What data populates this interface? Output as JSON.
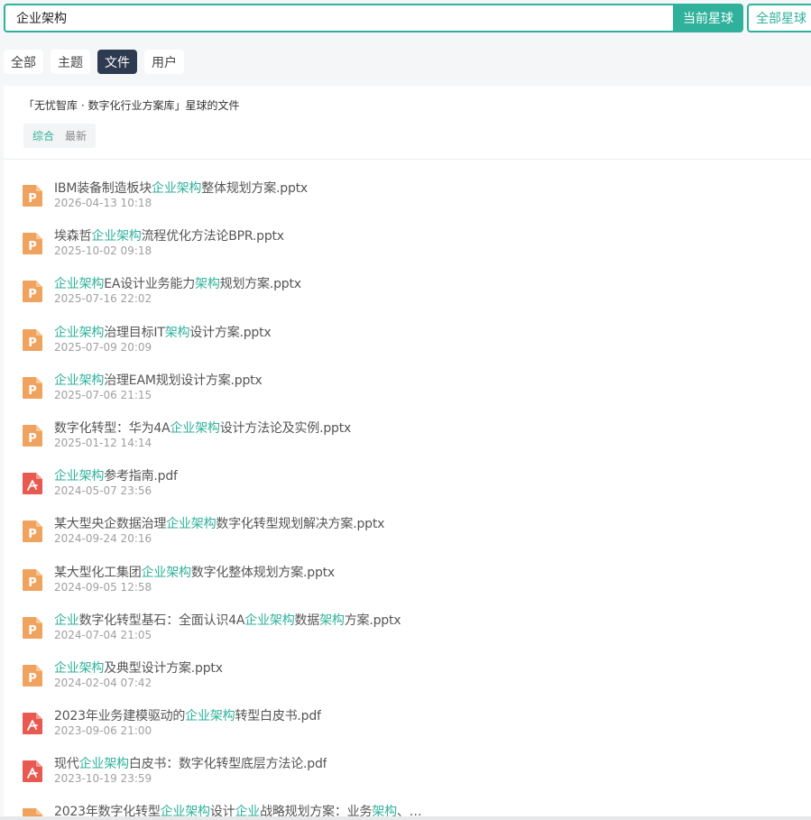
{
  "search": {
    "value": "企业架构",
    "current_button": "当前星球",
    "all_button": "全部星球"
  },
  "tabs": [
    {
      "label": "全部",
      "active": false
    },
    {
      "label": "主题",
      "active": false
    },
    {
      "label": "文件",
      "active": true
    },
    {
      "label": "用户",
      "active": false
    }
  ],
  "panel": {
    "scope_title": "「无忧智库 · 数字化行业方案库」星球的文件",
    "sort": [
      {
        "label": "综合",
        "active": true
      },
      {
        "label": "最新",
        "active": false
      }
    ]
  },
  "highlight_color": "#2fb19b",
  "files": [
    {
      "type": "pptx",
      "name": [
        {
          "t": "IBM装备制造板块"
        },
        {
          "t": "企业架构",
          "hl": true
        },
        {
          "t": "整体规划方案.pptx"
        }
      ],
      "time": "2026-04-13 10:18"
    },
    {
      "type": "pptx",
      "name": [
        {
          "t": "埃森哲"
        },
        {
          "t": "企业架构",
          "hl": true
        },
        {
          "t": "流程优化方法论BPR.pptx"
        }
      ],
      "time": "2025-10-02 09:18"
    },
    {
      "type": "pptx",
      "name": [
        {
          "t": "企业架构",
          "hl": true
        },
        {
          "t": "EA设计业务能力"
        },
        {
          "t": "架构",
          "hl": true
        },
        {
          "t": "规划方案.pptx"
        }
      ],
      "time": "2025-07-16 22:02"
    },
    {
      "type": "pptx",
      "name": [
        {
          "t": "企业架构",
          "hl": true
        },
        {
          "t": "治理目标IT"
        },
        {
          "t": "架构",
          "hl": true
        },
        {
          "t": "设计方案.pptx"
        }
      ],
      "time": "2025-07-09 20:09"
    },
    {
      "type": "pptx",
      "name": [
        {
          "t": "企业架构",
          "hl": true
        },
        {
          "t": "治理EAM规划设计方案.pptx"
        }
      ],
      "time": "2025-07-06 21:15"
    },
    {
      "type": "pptx",
      "name": [
        {
          "t": "数字化转型：华为4A"
        },
        {
          "t": "企业架构",
          "hl": true
        },
        {
          "t": "设计方法论及实例.pptx"
        }
      ],
      "time": "2025-01-12 14:14"
    },
    {
      "type": "pdf",
      "name": [
        {
          "t": "企业架构",
          "hl": true
        },
        {
          "t": "参考指南.pdf"
        }
      ],
      "time": "2024-05-07 23:56"
    },
    {
      "type": "pptx",
      "name": [
        {
          "t": "某大型央企数据治理"
        },
        {
          "t": "企业架构",
          "hl": true
        },
        {
          "t": "数字化转型规划解决方案.pptx"
        }
      ],
      "time": "2024-09-24 20:16"
    },
    {
      "type": "pptx",
      "name": [
        {
          "t": "某大型化工集团"
        },
        {
          "t": "企业架构",
          "hl": true
        },
        {
          "t": "数字化整体规划方案.pptx"
        }
      ],
      "time": "2024-09-05 12:58"
    },
    {
      "type": "pptx",
      "name": [
        {
          "t": "企业",
          "hl": true
        },
        {
          "t": "数字化转型基石：全面认识4A"
        },
        {
          "t": "企业架构",
          "hl": true
        },
        {
          "t": "数据"
        },
        {
          "t": "架构",
          "hl": true
        },
        {
          "t": "方案.pptx"
        }
      ],
      "time": "2024-07-04 21:05"
    },
    {
      "type": "pptx",
      "name": [
        {
          "t": "企业架构",
          "hl": true
        },
        {
          "t": "及典型设计方案.pptx"
        }
      ],
      "time": "2024-02-04 07:42"
    },
    {
      "type": "pdf",
      "name": [
        {
          "t": "2023年业务建模驱动的"
        },
        {
          "t": "企业架构",
          "hl": true
        },
        {
          "t": "转型白皮书.pdf"
        }
      ],
      "time": "2023-09-06 21:00"
    },
    {
      "type": "pdf",
      "name": [
        {
          "t": "现代"
        },
        {
          "t": "企业架构",
          "hl": true
        },
        {
          "t": "白皮书：数字化转型底层方法论.pdf"
        }
      ],
      "time": "2023-10-19 23:59"
    },
    {
      "type": "pptx",
      "name": [
        {
          "t": "2023年数字化转型"
        },
        {
          "t": "企业架构",
          "hl": true
        },
        {
          "t": "设计"
        },
        {
          "t": "企业",
          "hl": true
        },
        {
          "t": "战略规划方案：业务"
        },
        {
          "t": "架构",
          "hl": true
        },
        {
          "t": "、…"
        }
      ],
      "time": ""
    }
  ]
}
